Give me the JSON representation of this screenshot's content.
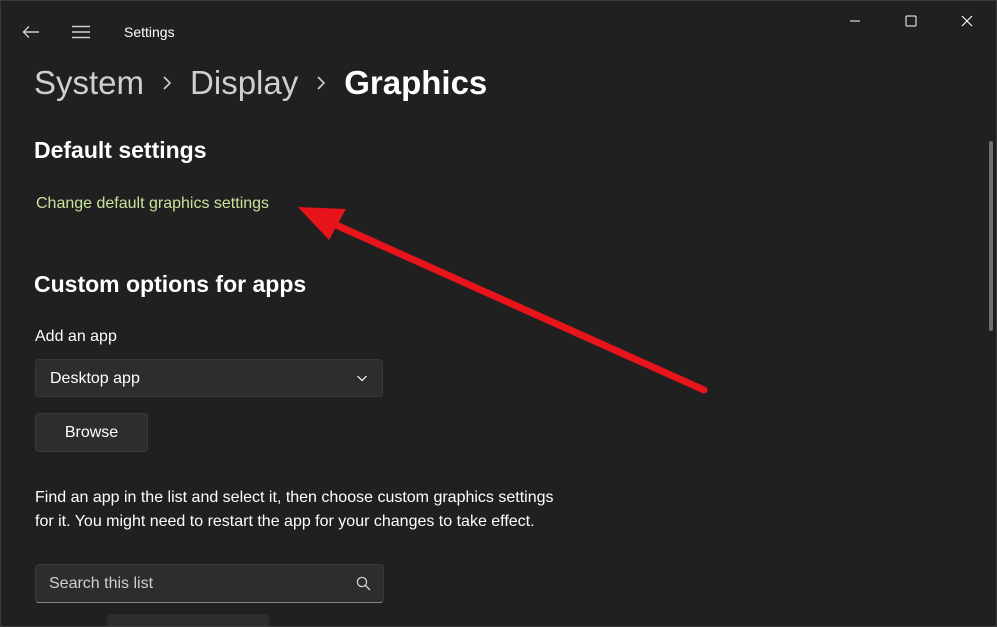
{
  "titlebar": {
    "app_title": "Settings",
    "icons": {
      "back": "back-arrow-icon",
      "menu": "hamburger-menu-icon",
      "minimize": "minimize-icon",
      "maximize": "maximize-icon",
      "close": "close-icon"
    }
  },
  "breadcrumb": {
    "items": [
      "System",
      "Display",
      "Graphics"
    ],
    "separator_icon": "chevron-right-icon"
  },
  "default_settings": {
    "heading": "Default settings",
    "link_text": "Change default graphics settings"
  },
  "custom_options": {
    "heading": "Custom options for apps",
    "add_app_label": "Add an app",
    "app_type_selected": "Desktop app",
    "browse_label": "Browse",
    "description": "Find an app in the list and select it, then choose custom graphics settings for it. You might need to restart the app for your changes to take effect.",
    "search_placeholder": "Search this list"
  },
  "colors": {
    "background": "#202020",
    "link": "#c8e29a",
    "control": "#2d2d2d",
    "annotation_arrow": "#e8141b"
  }
}
